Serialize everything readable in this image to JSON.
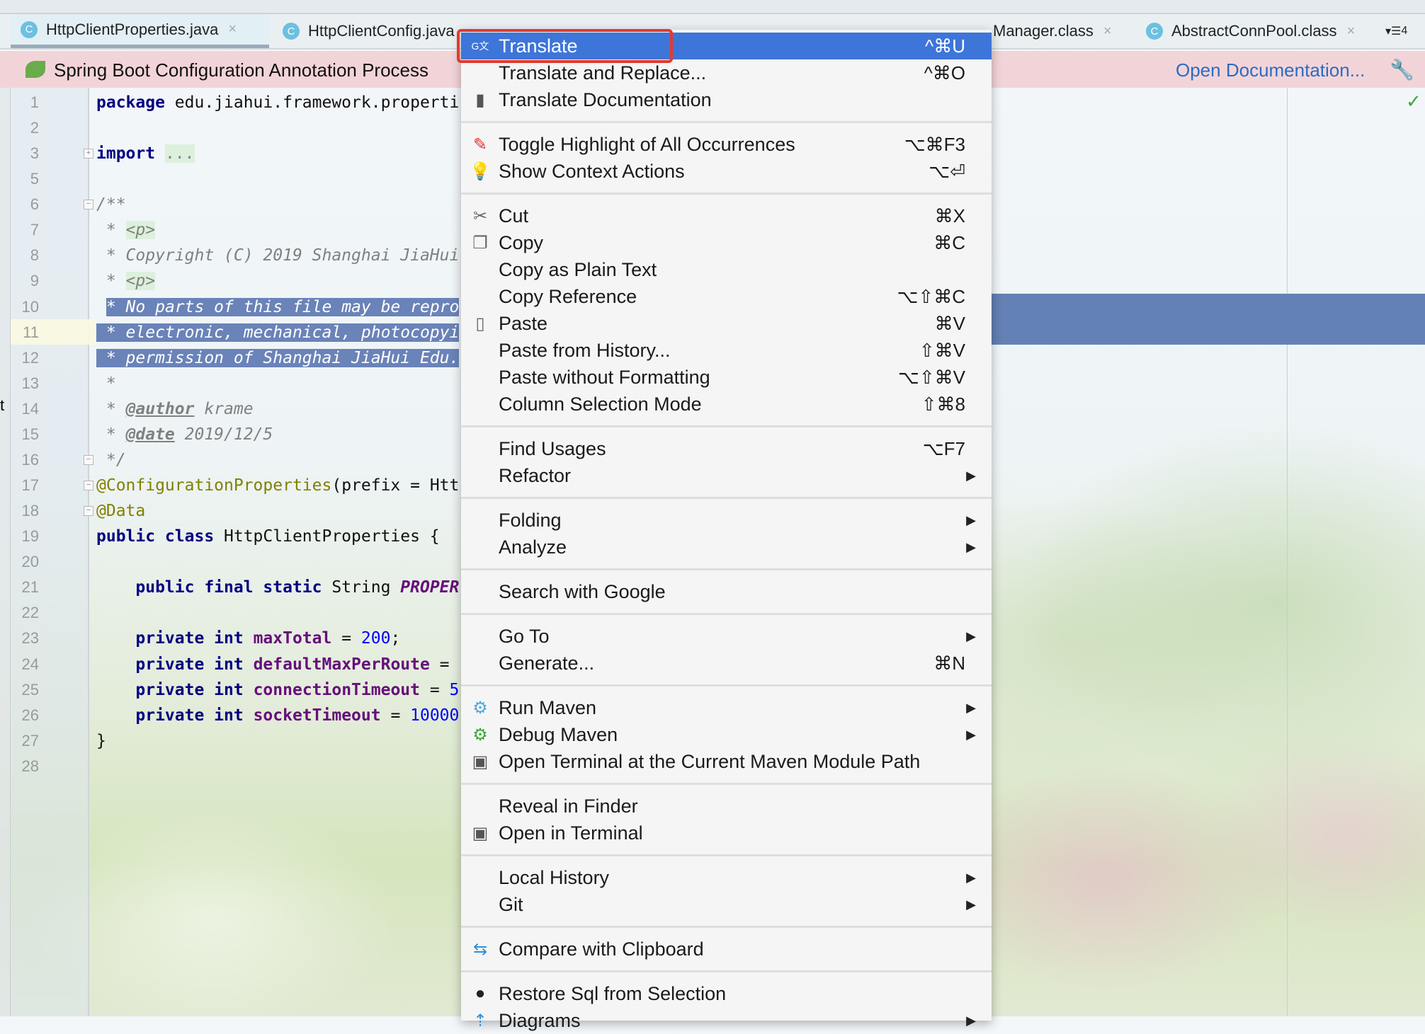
{
  "tabs": [
    {
      "label": "HttpClientProperties.java",
      "icon": "class-icon",
      "active": true
    },
    {
      "label": "HttpClientConfig.java",
      "icon": "class-icon"
    },
    {
      "label": "Manager.class",
      "icon": "class-icon"
    },
    {
      "label": "AbstractConnPool.class",
      "icon": "class-icon"
    }
  ],
  "tab_overflow": "4",
  "banner": {
    "title": "Spring Boot Configuration Annotation Process",
    "link": "Open Documentation..."
  },
  "left_strip_text": "t",
  "code": {
    "lines": [
      {
        "num": "1",
        "tokens": [
          {
            "t": "package",
            "k": "kw"
          },
          {
            "t": " edu.jiahui.framework.properti",
            "k": ""
          }
        ]
      },
      {
        "num": "2",
        "tokens": []
      },
      {
        "num": "3",
        "tokens": [
          {
            "t": "import",
            "k": "kw"
          },
          {
            "t": " ",
            "k": ""
          },
          {
            "t": "...",
            "k": "fold"
          }
        ]
      },
      {
        "num": "5",
        "tokens": []
      },
      {
        "num": "6",
        "tokens": [
          {
            "t": "/**",
            "k": "cm"
          }
        ]
      },
      {
        "num": "7",
        "tokens": [
          {
            "t": " * ",
            "k": "cm"
          },
          {
            "t": "<p>",
            "k": "tag"
          }
        ]
      },
      {
        "num": "8",
        "tokens": [
          {
            "t": " * Copyright (C) 2019 Shanghai JiaHui",
            "k": "cm"
          }
        ]
      },
      {
        "num": "9",
        "tokens": [
          {
            "t": " * ",
            "k": "cm"
          },
          {
            "t": "<p>",
            "k": "tag"
          }
        ]
      },
      {
        "num": "10",
        "tokens": [
          {
            "t": " ",
            "k": ""
          },
          {
            "t": "* No parts of this file may be repro",
            "k": "sel"
          }
        ]
      },
      {
        "num": "11",
        "tokens": [
          {
            "t": " * electronic, mechanical, photocopyi",
            "k": "sel"
          }
        ]
      },
      {
        "num": "12",
        "tokens": [
          {
            "t": " * permission of Shanghai JiaHui Edu.",
            "k": "sel"
          }
        ]
      },
      {
        "num": "13",
        "tokens": [
          {
            "t": " *",
            "k": "cm"
          }
        ]
      },
      {
        "num": "14",
        "tokens": [
          {
            "t": " * ",
            "k": "cm"
          },
          {
            "t": "@author",
            "k": "doct"
          },
          {
            "t": " krame",
            "k": "cm"
          }
        ]
      },
      {
        "num": "15",
        "tokens": [
          {
            "t": " * ",
            "k": "cm"
          },
          {
            "t": "@date",
            "k": "doct"
          },
          {
            "t": " 2019/12/5",
            "k": "cm"
          }
        ]
      },
      {
        "num": "16",
        "tokens": [
          {
            "t": " */",
            "k": "cm"
          }
        ]
      },
      {
        "num": "17",
        "tokens": [
          {
            "t": "@ConfigurationProperties",
            "k": "ann"
          },
          {
            "t": "(prefix = Htt",
            "k": ""
          }
        ]
      },
      {
        "num": "18",
        "tokens": [
          {
            "t": "@Data",
            "k": "ann"
          }
        ]
      },
      {
        "num": "19",
        "tokens": [
          {
            "t": "public class",
            "k": "kw"
          },
          {
            "t": " HttpClientProperties {",
            "k": ""
          }
        ]
      },
      {
        "num": "20",
        "tokens": []
      },
      {
        "num": "21",
        "tokens": [
          {
            "t": "    ",
            "k": ""
          },
          {
            "t": "public final static",
            "k": "kw"
          },
          {
            "t": " String ",
            "k": ""
          },
          {
            "t": "PROPER",
            "k": "cst"
          }
        ]
      },
      {
        "num": "22",
        "tokens": []
      },
      {
        "num": "23",
        "tokens": [
          {
            "t": "    ",
            "k": ""
          },
          {
            "t": "private int",
            "k": "kw"
          },
          {
            "t": " ",
            "k": ""
          },
          {
            "t": "maxTotal",
            "k": "fld"
          },
          {
            "t": " = ",
            "k": ""
          },
          {
            "t": "200",
            "k": "num"
          },
          {
            "t": ";",
            "k": ""
          }
        ]
      },
      {
        "num": "24",
        "tokens": [
          {
            "t": "    ",
            "k": ""
          },
          {
            "t": "private int",
            "k": "kw"
          },
          {
            "t": " ",
            "k": ""
          },
          {
            "t": "defaultMaxPerRoute",
            "k": "fld"
          },
          {
            "t": " =",
            "k": ""
          }
        ]
      },
      {
        "num": "25",
        "tokens": [
          {
            "t": "    ",
            "k": ""
          },
          {
            "t": "private int",
            "k": "kw"
          },
          {
            "t": " ",
            "k": ""
          },
          {
            "t": "connectionTimeout",
            "k": "fld"
          },
          {
            "t": " = ",
            "k": ""
          },
          {
            "t": "5",
            "k": "num"
          }
        ]
      },
      {
        "num": "26",
        "tokens": [
          {
            "t": "    ",
            "k": ""
          },
          {
            "t": "private int",
            "k": "kw"
          },
          {
            "t": " ",
            "k": ""
          },
          {
            "t": "socketTimeout",
            "k": "fld"
          },
          {
            "t": " = ",
            "k": ""
          },
          {
            "t": "10000",
            "k": "num"
          }
        ]
      },
      {
        "num": "27",
        "tokens": [
          {
            "t": "}",
            "k": ""
          }
        ]
      },
      {
        "num": "28",
        "tokens": []
      }
    ]
  },
  "menu": {
    "sections": [
      [
        {
          "label": "Translate",
          "shortcut": "^⌘U",
          "icon": "translate-icon",
          "highlighted": true
        },
        {
          "label": "Translate and Replace...",
          "shortcut": "^⌘O"
        },
        {
          "label": "Translate Documentation",
          "icon": "document-icon"
        }
      ],
      [
        {
          "label": "Toggle Highlight of All Occurrences",
          "shortcut": "⌥⌘F3",
          "icon": "highlighter-icon"
        },
        {
          "label": "Show Context Actions",
          "shortcut": "⌥⏎",
          "icon": "lightbulb-icon"
        }
      ],
      [
        {
          "label": "Cut",
          "shortcut": "⌘X",
          "icon": "scissors-icon"
        },
        {
          "label": "Copy",
          "shortcut": "⌘C",
          "icon": "copy-icon"
        },
        {
          "label": "Copy as Plain Text"
        },
        {
          "label": "Copy Reference",
          "shortcut": "⌥⇧⌘C"
        },
        {
          "label": "Paste",
          "shortcut": "⌘V",
          "icon": "clipboard-icon"
        },
        {
          "label": "Paste from History...",
          "shortcut": "⇧⌘V"
        },
        {
          "label": "Paste without Formatting",
          "shortcut": "⌥⇧⌘V"
        },
        {
          "label": "Column Selection Mode",
          "shortcut": "⇧⌘8"
        }
      ],
      [
        {
          "label": "Find Usages",
          "shortcut": "⌥F7"
        },
        {
          "label": "Refactor",
          "submenu": true
        }
      ],
      [
        {
          "label": "Folding",
          "submenu": true
        },
        {
          "label": "Analyze",
          "submenu": true
        }
      ],
      [
        {
          "label": "Search with Google"
        }
      ],
      [
        {
          "label": "Go To",
          "submenu": true
        },
        {
          "label": "Generate...",
          "shortcut": "⌘N"
        }
      ],
      [
        {
          "label": "Run Maven",
          "submenu": true,
          "icon": "gear-blue-icon"
        },
        {
          "label": "Debug Maven",
          "submenu": true,
          "icon": "gear-green-icon"
        },
        {
          "label": "Open Terminal at the Current Maven Module Path",
          "icon": "terminal-icon"
        }
      ],
      [
        {
          "label": "Reveal in Finder"
        },
        {
          "label": "Open in Terminal",
          "icon": "terminal-icon"
        }
      ],
      [
        {
          "label": "Local History",
          "submenu": true
        },
        {
          "label": "Git",
          "submenu": true
        }
      ],
      [
        {
          "label": "Compare with Clipboard",
          "icon": "compare-icon"
        }
      ],
      [
        {
          "label": "Restore Sql from Selection",
          "icon": "sql-icon"
        },
        {
          "label": "Diagrams",
          "submenu": true,
          "icon": "diagram-icon"
        }
      ]
    ]
  },
  "colors": {
    "menu_highlight": "#3e75d9",
    "annotation_box": "#e23a2f",
    "selection": "#6a83b8",
    "banner": "#f2d0d4",
    "link": "#2b6cc4"
  }
}
